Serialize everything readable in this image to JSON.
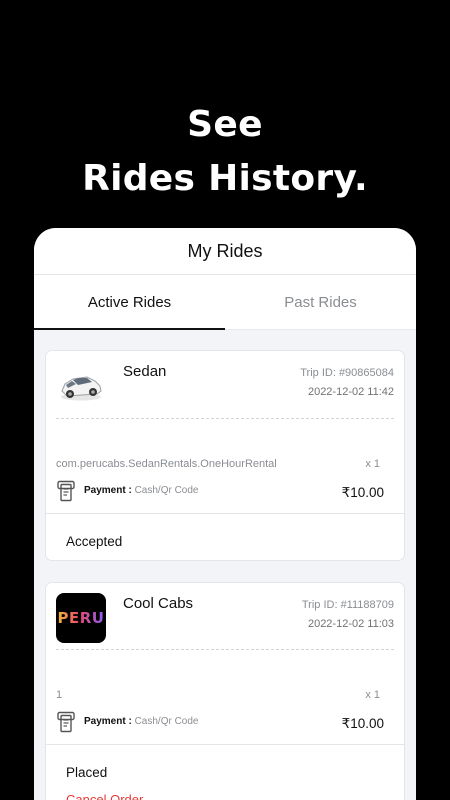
{
  "promo": {
    "line1": "See",
    "line2": "Rides History."
  },
  "appbar": {
    "title": "My Rides"
  },
  "tabs": [
    {
      "label": "Active Rides",
      "active": true
    },
    {
      "label": "Past Rides",
      "active": false
    }
  ],
  "rides": [
    {
      "name": "Sedan",
      "trip_id": "Trip ID: #90865084",
      "datetime": "2022-12-02 11:42",
      "product": "com.perucabs.SedanRentals.OneHourRental",
      "quantity": "x 1",
      "payment_label": "Payment :",
      "payment_method": "Cash/Qr Code",
      "amount": "₹10.00",
      "status": "Accepted",
      "thumbnail": "white-car"
    },
    {
      "name": "Cool Cabs",
      "trip_id": "Trip ID: #11188709",
      "datetime": "2022-12-02 11:03",
      "product": "1",
      "quantity": "x 1",
      "payment_label": "Payment :",
      "payment_method": "Cash/Qr Code",
      "amount": "₹10.00",
      "status": "Placed",
      "cancel_label": "Cancel Order",
      "thumbnail": "peru-logo",
      "logo_text": "PERU"
    }
  ],
  "colors": {
    "background": "#000000",
    "surface": "#ffffff",
    "list_background": "#f2f4f7",
    "muted_text": "#8a8d92",
    "cancel": "#e53935"
  }
}
